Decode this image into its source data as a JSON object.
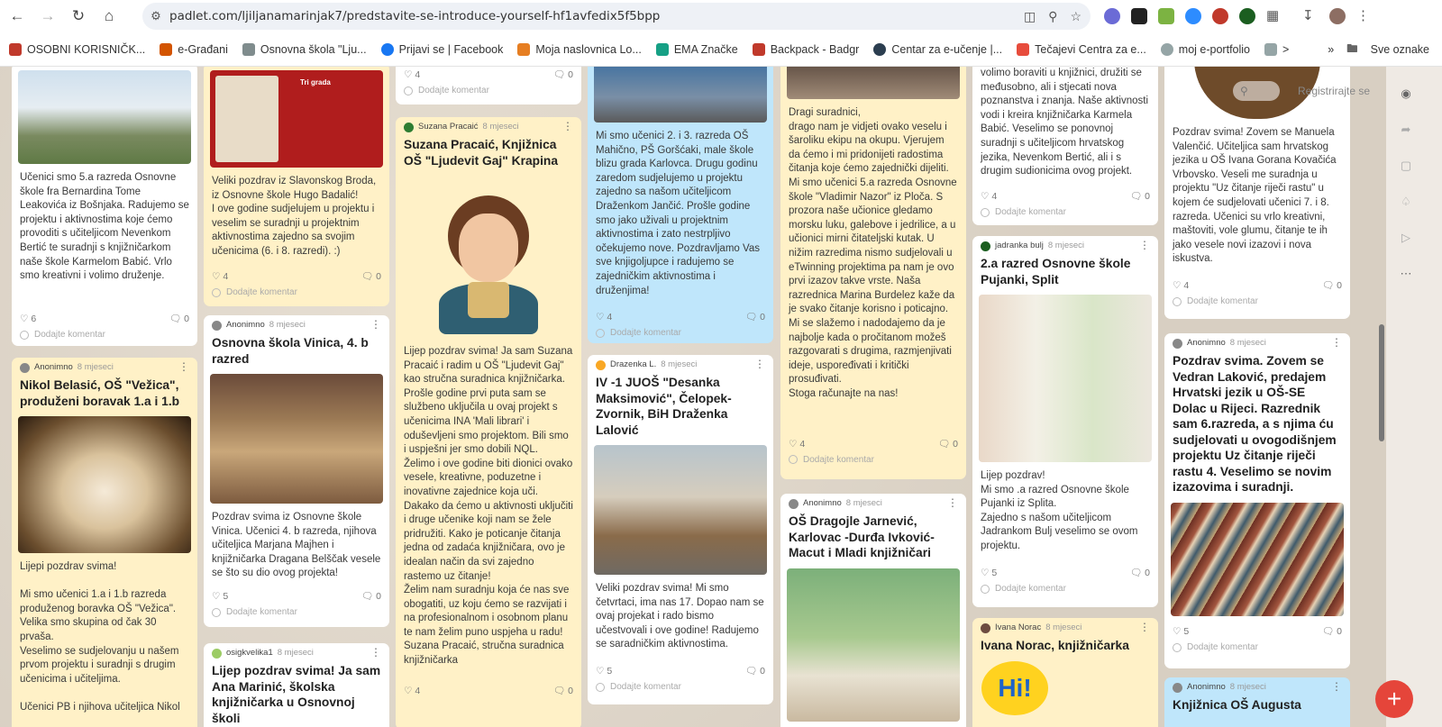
{
  "browser": {
    "url": "padlet.com/ljiljanamarinjak7/predstavite-se-introduce-yourself-hf1avfedix5f5bpp",
    "bookmarks": [
      {
        "label": "OSOBNI KORISNIČK...",
        "color": "#c0392b"
      },
      {
        "label": "e-Građani",
        "color": "#d35400"
      },
      {
        "label": "Osnovna škola \"Lju...",
        "color": "#7f8c8d"
      },
      {
        "label": "Prijavi se | Facebook",
        "color": "#1877f2"
      },
      {
        "label": "Moja naslovnica Lo...",
        "color": "#e67e22"
      },
      {
        "label": "EMA Značke",
        "color": "#16a085"
      },
      {
        "label": "Backpack - Badgr",
        "color": "#c0392b"
      },
      {
        "label": "Centar za e-učenje |...",
        "color": "#2c3e50"
      },
      {
        "label": "Tečajevi Centra za e...",
        "color": "#e74c3c"
      },
      {
        "label": "moj e-portfolio",
        "color": "#95a5a6"
      },
      {
        "label": ">",
        "color": "#95a5a6"
      }
    ],
    "all_bookmarks": "Sve oznake"
  },
  "board": {
    "search_placeholder": "",
    "register": "Registrirajte se",
    "comment_label": "Dodajte komentar",
    "cards": [
      {
        "id": "c1",
        "body": "Učenici smo 5.a razreda Osnovne škole fra Bernardina Tome Leakovića iz Bošnjaka. Radujemo se projektu i aktivnostima koje ćemo provoditi s učiteljicom Nevenkom\n Bertić te  suradnji s knjižničarkom naše škole Karmelom Babić. Vrlo smo kreativni i volimo druženje.",
        "likes": "6",
        "comments": "0"
      },
      {
        "id": "c2",
        "author": "Anonimno",
        "time": "8 mjeseci",
        "title": "Nikol Belasić, OŠ \"Vežica\", produženi boravak 1.a i 1.b",
        "body": "Lijepi pozdrav svima!\n\nMi smo učenici 1.a i 1.b razreda produženog boravka OŠ \"Vežica\". Velika smo skupina od čak 30 prvaša.\nVeselimo se sudjelovanju u našem prvom projektu i suradnji s drugim učenicima i učiteljima.\n\nUčenici PB i njihova učiteljica Nikol"
      },
      {
        "id": "c3",
        "image_caption": "Tri grada",
        "body": "Veliki pozdrav iz Slavonskog Broda, iz Osnovne škole Hugo Badalić!\nI ove godine sudjelujem u projektu i veselim se suradnji u projektnim aktivnostima zajedno sa svojim učenicima (6. i 8. razredi).  :)",
        "likes": "4",
        "comments": "0"
      },
      {
        "id": "c4",
        "author": "Anonimno",
        "time": "8 mjeseci",
        "title": "Osnovna škola Vinica, 4. b razred",
        "body": "Pozdrav svima iz Osnovne škole Vinica. Učenici 4. b razreda, njihova učiteljica Marjana Majhen i knjižničarka Dragana Belščak vesele se što su dio ovog projekta!",
        "likes": "5",
        "comments": "0"
      },
      {
        "id": "c5",
        "author": "osigkvelika1",
        "time": "8 mjeseci",
        "title": "Lijep pozdrav svima! Ja sam Ana Marinić, školska knjižničarka u Osnovnoj školi"
      },
      {
        "id": "c6",
        "likes": "4",
        "comments": "0"
      },
      {
        "id": "c7",
        "author": "Suzana Pracaić",
        "time": "8 mjeseci",
        "title": "Suzana Pracaić, Knjižnica OŠ \"Ljudevit Gaj\" Krapina",
        "body": "Lijep pozdrav svima! Ja sam Suzana Pracaić i radim u OŠ \"Ljudevit Gaj\" kao stručna suradnica knjižničarka. Prošle godine prvi puta sam se službeno uključila u ovaj projekt s učenicima INA 'Mali librari' i oduševljeni smo projektom. Bili smo i uspješni jer smo dobili NQL.\nŽelimo i ove godine biti dionici ovako vesele, kreativne, poduzetne i inovativne zajednice koja uči.\nDakako da ćemo u aktivnosti uključiti i druge učenike koji nam se žele pridružiti. Kako je poticanje čitanja jedna od zadaća knjižničara, ovo je idealan način da svi zajedno rastemo uz čitanje!\nŽelim nam suradnju koja će nas sve obogatiti, uz koju ćemo se razvijati i na profesionalnom i osobnom planu te nam želim puno uspjeha u radu!\nSuzana Pracaić, stručna suradnica knjižničarka",
        "likes": "4",
        "comments": "0"
      },
      {
        "id": "c8",
        "body": "Mi smo učenici 2. i 3. razreda OŠ Mahično, PŠ Goršćaki, male škole blizu grada Karlovca. Drugu godinu zaredom sudjelujemo u projektu zajedno sa našom učiteljicom Draženkom Jančić. Prošle godine smo jako uživali u projektnim aktivnostima i zato nestrpljivo očekujemo nove. Pozdravljamo Vas sve knjigoljupce  i radujemo se zajedničkim aktivnostima i druženjima!",
        "likes": "4",
        "comments": "0"
      },
      {
        "id": "c9",
        "author": "Drazenka L.",
        "time": "8 mjeseci",
        "title": "IV -1 JUOŠ \"Desanka Maksimović\", Čelopek- Zvornik, BiH           Draženka Lalović",
        "body": "Veliki pozdrav svima! Mi smo četvrtaci, ima nas 17. Dopao nam se ovaj projekat i rado bismo učestvovali i ove godine! Radujemo se saradničkim aktivnostima.",
        "likes": "5",
        "comments": "0"
      },
      {
        "id": "c10",
        "body": "Dragi suradnici,\ndrago nam je vidjeti ovako veselu i šaroliku ekipu na okupu. Vjerujem da ćemo i mi pridonijeti radostima čitanja koje ćemo zajednički dijeliti.\nMi smo učenici 5.a razreda Osnovne škole \"Vladimir Nazor\" iz Ploča. S prozora naše učionice gledamo morsku luku, galebove i jedrilice, a u učionici mirni čitateljski kutak. U nižim razredima nismo sudjelovali u eTwinning projektima pa nam je ovo prvi izazov takve vrste. Naša razrednica Marina Burdelez kaže da je svako čitanje korisno i poticajno. Mi se slažemo i nadodajemo da je najbolje kada o pročitanom možeš razgovarati s drugima, razmjenjivati ideje, uspoređivati i kritički prosuđivati.\nStoga računajte na nas!",
        "likes": "4",
        "comments": "0"
      },
      {
        "id": "c11",
        "author": "Anonimno",
        "time": "8 mjeseci",
        "title": "OŠ Dragojle Jarnević, Karlovac -Durđa Ivković-Macut i Mladi knjižničari"
      },
      {
        "id": "c12",
        "body": "volimo boraviti u knjižnici, družiti se međusobno, ali i stjecati nova poznanstva i znanja. Naše aktivnosti vodi i kreira knjižničarka Karmela Babić. Veselimo se ponovnoj suradnji s učiteljicom hrvatskog jezika, Nevenkom Bertić, ali i s drugim sudionicima ovog projekt.",
        "likes": "4",
        "comments": "0"
      },
      {
        "id": "c13",
        "author": "jadranka bulj",
        "time": "8 mjeseci",
        "title": "2.a razred Osnovne škole Pujanki, Split",
        "body": "Lijep pozdrav!\nMi smo .a razred Osnovne škole Pujanki iz Splita.\nZajedno s našom učiteljicom Jadrankom Bulj veselimo se ovom projektu.",
        "likes": "5",
        "comments": "0"
      },
      {
        "id": "c14",
        "author": "Ivana Norac",
        "time": "8 mjeseci",
        "title": "Ivana Norac, knjižničarka",
        "image_caption": "Hi!"
      },
      {
        "id": "c15",
        "body": "Pozdrav svima! Zovem se Manuela Valenčić. Učiteljica sam hrvatskog jezika u OŠ Ivana Gorana Kovačića Vrbovsko. Veseli me suradnja u projektu \"Uz čitanje riječi rastu\" u kojem će sudjelovati učenici 7. i 8. razreda. Učenici su vrlo kreativni, maštoviti, vole glumu, čitanje te ih jako vesele novi izazovi i nova iskustva.",
        "likes": "4",
        "comments": "0"
      },
      {
        "id": "c16",
        "author": "Anonimno",
        "time": "8 mjeseci",
        "title": "Pozdrav svima. Zovem se Vedran Laković, predajem Hrvatski jezik u OŠ-SE Dolac u Rijeci. Razrednik sam 6.razreda, a s njima ću sudjelovati u ovogodišnjem projektu Uz čitanje riječi rastu 4. Veselimo se novim izazovima i suradnji.",
        "likes": "5",
        "comments": "0"
      },
      {
        "id": "c17",
        "author": "Anonimno",
        "time": "8 mjeseci",
        "title": "Knjižnica OŠ Augusta"
      }
    ]
  }
}
